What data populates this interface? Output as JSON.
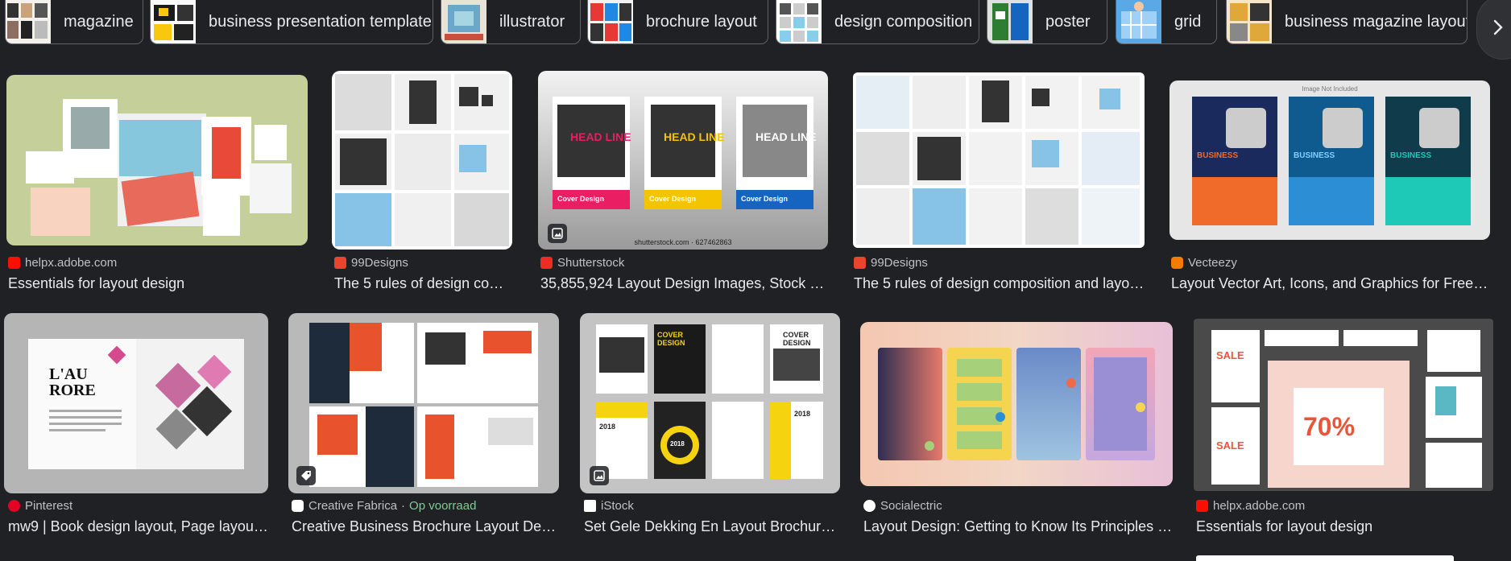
{
  "chips": [
    {
      "label": "magazine"
    },
    {
      "label": "business presentation template"
    },
    {
      "label": "illustrator"
    },
    {
      "label": "brochure layout"
    },
    {
      "label": "design composition"
    },
    {
      "label": "poster"
    },
    {
      "label": "grid"
    },
    {
      "label": "business magazine layout"
    }
  ],
  "results": [
    {
      "source": "helpx.adobe.com",
      "title": "Essentials for layout design"
    },
    {
      "source": "99Designs",
      "title": "The 5 rules of design com…"
    },
    {
      "source": "Shutterstock",
      "title": "35,855,924 Layout Design Images, Stock …",
      "image_text": "shutterstock.com · 627462863",
      "poster_text": [
        "HEAD LINE",
        "HEAD LINE",
        "HEAD LINE"
      ],
      "poster_sub": [
        "Cover Design",
        "Cover Design",
        "Cover Design"
      ]
    },
    {
      "source": "99Designs",
      "title": "The 5 rules of design composition and layo…"
    },
    {
      "source": "Vecteezy",
      "title": "Layout Vector Art, Icons, and Graphics for Free …",
      "image_text": "Image Not Included",
      "poster_text": [
        "BUSINESS",
        "BUSINESS",
        "BUSINESS"
      ]
    },
    {
      "source": "Pinterest",
      "title": "mw9 | Book design layout, Page layou…",
      "image_text": "L'AU RORE"
    },
    {
      "source": "Creative Fabrica",
      "stock": "Op voorraad",
      "title": "Creative Business Brochure Layout De…"
    },
    {
      "source": "iStock",
      "title": "Set Gele Dekking En Layout Brochur…",
      "poster_text": [
        "COVER DESIGN",
        "COVER DESIGN",
        "2018",
        "2018",
        "2018"
      ]
    },
    {
      "source": "Socialectric",
      "title": "Layout Design: Getting to Know Its Principles …"
    },
    {
      "source": "helpx.adobe.com",
      "title": "Essentials for layout design",
      "poster_text": [
        "SALE",
        "70%",
        "SALE"
      ]
    }
  ],
  "separator": "·",
  "colors": {
    "background": "#202124",
    "chip_border": "#5f6368",
    "text": "#e8eaed",
    "meta": "#bdc1c6",
    "stock": "#81c995"
  }
}
